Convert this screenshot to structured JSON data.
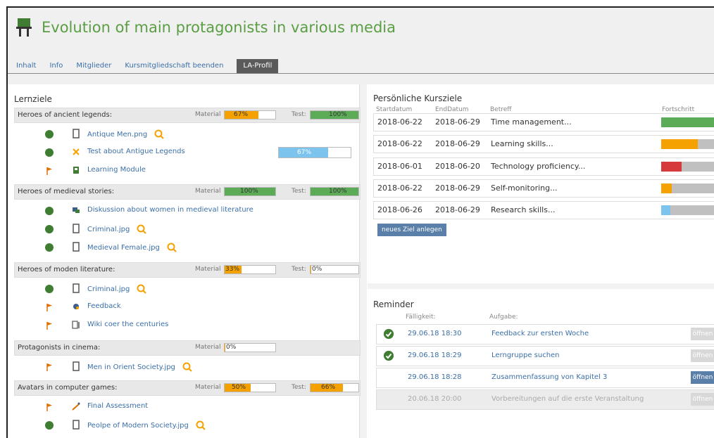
{
  "header": {
    "title": "Evolution of main protagonists in various media",
    "tabs": [
      "Inhalt",
      "Info",
      "Mitglieder",
      "Kursmitgliedschaft beenden",
      "LA-Profil"
    ]
  },
  "lernziele": {
    "title": "Lernziele",
    "material_label": "Material",
    "test_label": "Test:",
    "groups": [
      {
        "name": "Heroes of ancient legends:",
        "material": "67%",
        "test": "100%"
      },
      {
        "name": "Heroes of medieval stories:",
        "material": "100%",
        "test": "100%"
      },
      {
        "name": "Heroes of moden literature:",
        "material": "33%",
        "test": "0%"
      },
      {
        "name": "Protagonists in cinema:",
        "material": "0%"
      },
      {
        "name": "Avatars in computer games:",
        "material": "50%",
        "test": "66%"
      }
    ],
    "items": [
      {
        "label": "Antique Men.png",
        "progress": ""
      },
      {
        "label": "Test about Antigue Legends",
        "progress": "67%"
      },
      {
        "label": "Learning Module"
      },
      {
        "label": "Diskussion about women in medieval literature"
      },
      {
        "label": "Criminal.jpg"
      },
      {
        "label": "Medieval Female.jpg"
      },
      {
        "label": "Criminal.jpg"
      },
      {
        "label": "Feedback"
      },
      {
        "label": "Wiki coer the centuries"
      },
      {
        "label": "Men in Orient Society.jpg"
      },
      {
        "label": "Final Assessment"
      },
      {
        "label": "Peolpe of Modern Society.jpg"
      }
    ]
  },
  "kursziele": {
    "title": "Persönliche Kursziele",
    "headers": [
      "Startdatum",
      "EndDatum",
      "Betreff",
      "Fortschritt"
    ],
    "rows": [
      {
        "start": "2018-06-22",
        "end": "2018-06-29",
        "subject": "Time management...",
        "progress": 1.0,
        "color": "#5cac57"
      },
      {
        "start": "2018-06-22",
        "end": "2018-06-29",
        "subject": "Learning skills...",
        "progress": 0.68,
        "color": "#f5a100"
      },
      {
        "start": "2018-06-01",
        "end": "2018-06-20",
        "subject": "Technology proficiency...",
        "progress": 0.38,
        "color": "#d63a3a"
      },
      {
        "start": "2018-06-22",
        "end": "2018-06-29",
        "subject": "Self-monitoring...",
        "progress": 0.2,
        "color": "#f5a100"
      },
      {
        "start": "2018-06-26",
        "end": "2018-06-29",
        "subject": "Research skills...",
        "progress": 0.17,
        "color": "#7cc3ee"
      }
    ],
    "new_button": "neues Ziel anlegen"
  },
  "reminder": {
    "title": "Reminder",
    "headers": [
      "Fälligkeit:",
      "Aufgabe:"
    ],
    "rows": [
      {
        "date": "29.06.18 18:30",
        "task": "Feedback zur ersten Woche",
        "open": "öffnen"
      },
      {
        "date": "29.06.18 18:29",
        "task": "Lerngruppe suchen",
        "open": "öffnen"
      },
      {
        "date": "29.06.18 18:28",
        "task": "Zusammenfassung von Kapitel 3",
        "open": "öffnen"
      },
      {
        "date": "20.06.18 20:00",
        "task": "Vorbereitungen auf die erste Veranstaltung",
        "open": "öffnen"
      }
    ]
  },
  "colors": {
    "accent": "#5a9e44",
    "link": "#3b6fa8",
    "orange": "#f5a100",
    "green": "#5cac57",
    "blue": "#7cc3ee"
  }
}
